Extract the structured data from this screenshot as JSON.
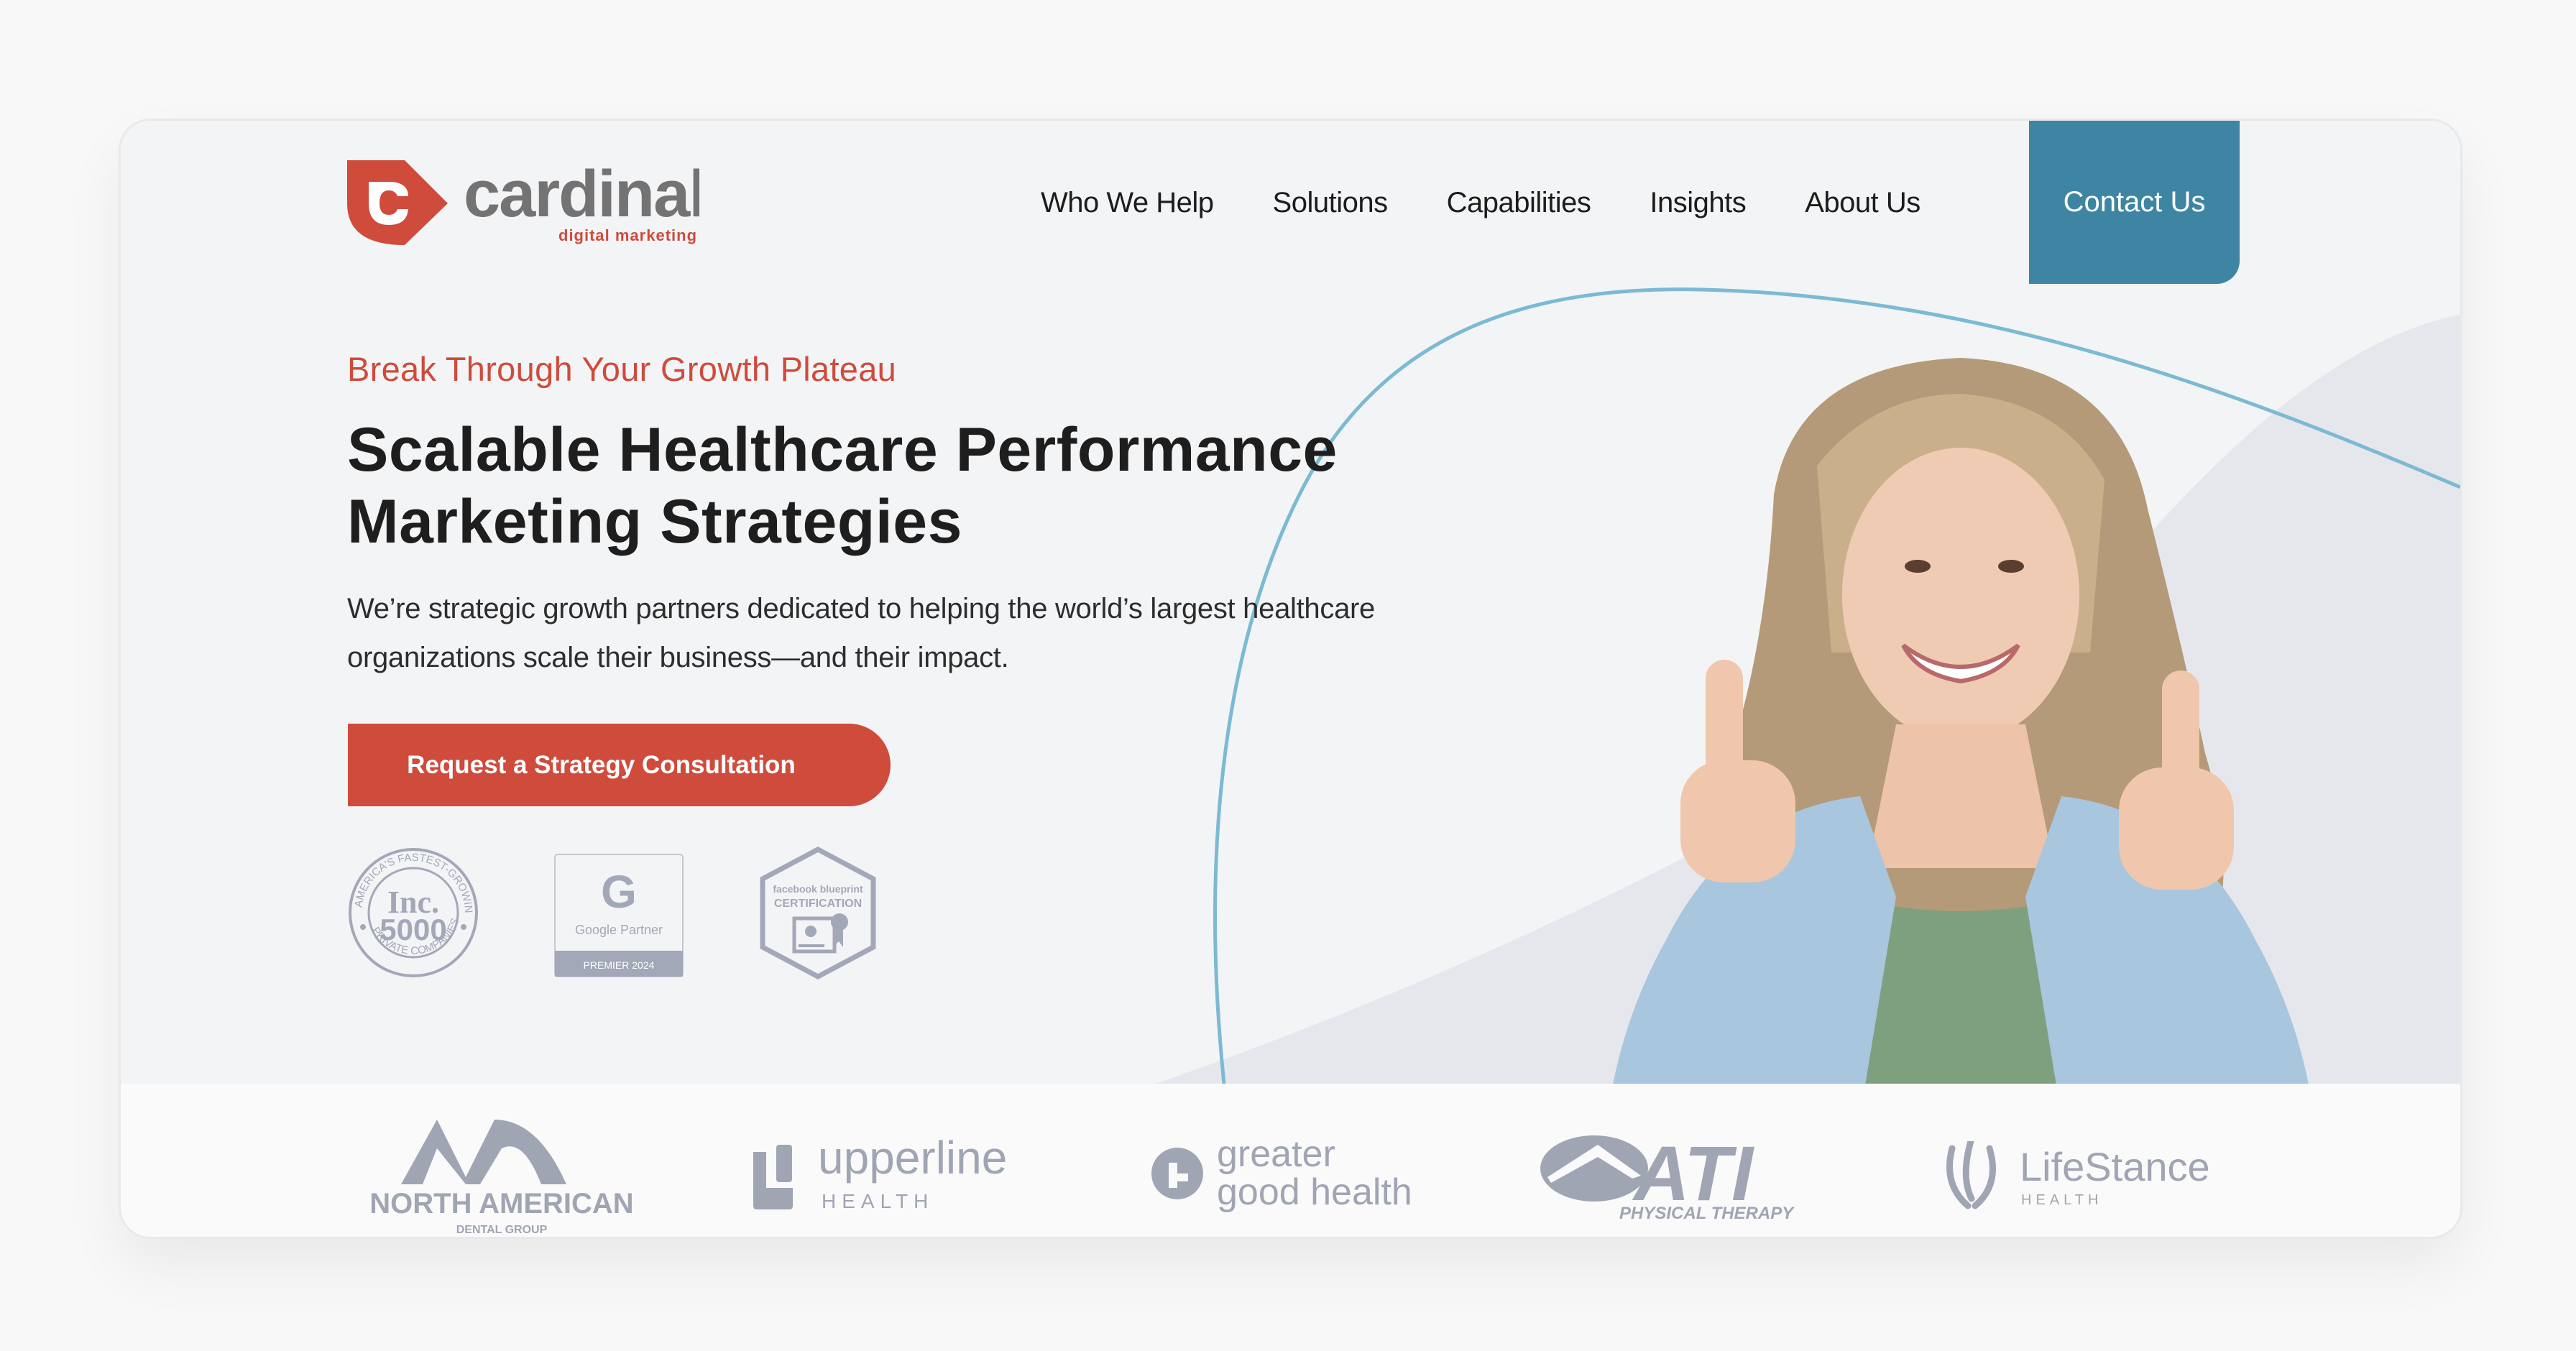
{
  "brand": {
    "name": "cardinal",
    "subtitle": "digital marketing",
    "logo_icon": "cardinal-c-teardrop-icon",
    "colors": {
      "primary_red": "#cf4b3c",
      "logo_gray": "#737373",
      "accent_blue": "#3e85a3",
      "curve_blue": "#7bbad3"
    }
  },
  "nav": {
    "items": [
      {
        "label": "Who We Help"
      },
      {
        "label": "Solutions"
      },
      {
        "label": "Capabilities"
      },
      {
        "label": "Insights"
      },
      {
        "label": "About Us"
      }
    ],
    "contact_label": "Contact Us"
  },
  "hero": {
    "tagline": "Break Through Your Growth Plateau",
    "headline_line1": "Scalable Healthcare Performance",
    "headline_line2": "Marketing Strategies",
    "paragraph_line1": "We’re strategic growth partners dedicated to helping the world’s largest healthcare",
    "paragraph_line2": "organizations scale their business—and their impact.",
    "cta_label": "Request a Strategy Consultation",
    "photo_alt": "Smiling woman in denim jacket giving two thumbs up"
  },
  "badges": [
    {
      "name": "inc-5000",
      "top_text": "AMERICA'S FASTEST-GROWING",
      "main1": "Inc.",
      "main2": "5000",
      "bottom_text": "PRIVATE COMPANIES"
    },
    {
      "name": "google-partner",
      "letter": "G",
      "label": "Google Partner",
      "footer": "PREMIER 2024"
    },
    {
      "name": "facebook-blueprint",
      "line1": "facebook blueprint",
      "line2": "CERTIFICATION"
    }
  ],
  "clients": [
    {
      "name": "north-american-dental-group",
      "line1": "NORTH AMERICAN",
      "line2": "DENTAL GROUP"
    },
    {
      "name": "upperline-health",
      "line1": "upperline",
      "line2": "HEALTH"
    },
    {
      "name": "greater-good-health",
      "line1": "greater",
      "line2": "good health"
    },
    {
      "name": "ati-physical-therapy",
      "line1": "ATI",
      "line2": "PHYSICAL THERAPY"
    },
    {
      "name": "lifestance-health",
      "line1": "LifeStance",
      "line2": "HEALTH"
    }
  ]
}
